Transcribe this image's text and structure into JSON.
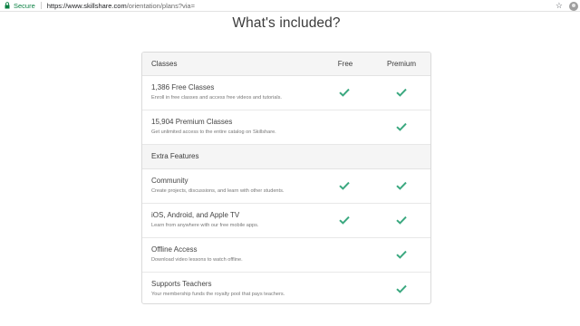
{
  "browser": {
    "secure_label": "Secure",
    "url_host": "https://www.skillshare.com",
    "url_path": "/orientation/plans?via="
  },
  "page": {
    "title": "What's included?"
  },
  "table": {
    "header": {
      "label": "Classes",
      "col_free": "Free",
      "col_premium": "Premium"
    },
    "classes": [
      {
        "title": "1,386 Free Classes",
        "desc": "Enroll in free classes and access free videos and tutorials.",
        "free": true,
        "premium": true
      },
      {
        "title": "15,904 Premium Classes",
        "desc": "Get unlimited access to the entire catalog on Skillshare.",
        "free": false,
        "premium": true
      }
    ],
    "extra_header": "Extra Features",
    "extras": [
      {
        "title": "Community",
        "desc": "Create projects, discussions, and learn with other students.",
        "free": true,
        "premium": true
      },
      {
        "title": "iOS, Android, and Apple TV",
        "desc": "Learn from anywhere with our free mobile apps.",
        "free": true,
        "premium": true
      },
      {
        "title": "Offline Access",
        "desc": "Download video lessons to watch offline.",
        "free": false,
        "premium": true
      },
      {
        "title": "Supports Teachers",
        "desc": "Your membership funds the royalty pool that pays teachers.",
        "free": false,
        "premium": true
      }
    ]
  },
  "colors": {
    "check": "#3aa87f",
    "secure": "#0b8043"
  }
}
